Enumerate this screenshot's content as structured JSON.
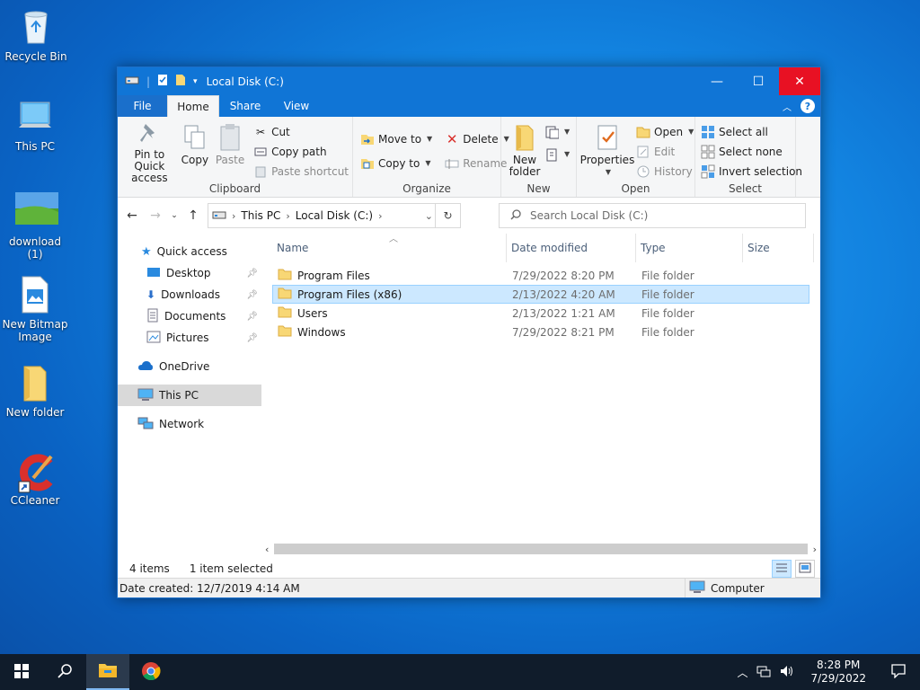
{
  "desktop": {
    "icons": [
      {
        "label": "Recycle Bin"
      },
      {
        "label": "This PC"
      },
      {
        "label": "download (1)"
      },
      {
        "label": "New Bitmap Image"
      },
      {
        "label": "New folder"
      },
      {
        "label": "CCleaner"
      }
    ]
  },
  "window": {
    "title": "Local Disk (C:)",
    "tabs": {
      "file": "File",
      "home": "Home",
      "share": "Share",
      "view": "View"
    },
    "ribbon": {
      "clipboard": {
        "label": "Clipboard",
        "pin": "Pin to Quick access",
        "copy": "Copy",
        "paste": "Paste",
        "cut": "Cut",
        "copy_path": "Copy path",
        "paste_shortcut": "Paste shortcut"
      },
      "organize": {
        "label": "Organize",
        "move_to": "Move to",
        "copy_to": "Copy to",
        "delete": "Delete",
        "rename": "Rename"
      },
      "new": {
        "label": "New",
        "new_folder": "New folder"
      },
      "open": {
        "label": "Open",
        "properties": "Properties",
        "open": "Open",
        "edit": "Edit",
        "history": "History"
      },
      "select": {
        "label": "Select",
        "select_all": "Select all",
        "select_none": "Select none",
        "invert": "Invert selection"
      }
    },
    "address": {
      "crumb1": "This PC",
      "crumb2": "Local Disk (C:)"
    },
    "search": {
      "placeholder": "Search Local Disk (C:)"
    },
    "nav": {
      "quick_access": "Quick access",
      "desktop": "Desktop",
      "downloads": "Downloads",
      "documents": "Documents",
      "pictures": "Pictures",
      "onedrive": "OneDrive",
      "this_pc": "This PC",
      "network": "Network"
    },
    "columns": {
      "name": "Name",
      "date": "Date modified",
      "type": "Type",
      "size": "Size"
    },
    "files": [
      {
        "name": "Program Files",
        "date": "7/29/2022 8:20 PM",
        "type": "File folder"
      },
      {
        "name": "Program Files (x86)",
        "date": "2/13/2022 4:20 AM",
        "type": "File folder"
      },
      {
        "name": "Users",
        "date": "2/13/2022 1:21 AM",
        "type": "File folder"
      },
      {
        "name": "Windows",
        "date": "7/29/2022 8:21 PM",
        "type": "File folder"
      }
    ],
    "status": {
      "items": "4 items",
      "selected": "1 item selected",
      "details": "Date created: 12/7/2019 4:14 AM",
      "location": "Computer"
    }
  },
  "taskbar": {
    "time": "8:28 PM",
    "date": "7/29/2022"
  },
  "colors": {
    "titlebar": "#1075d6",
    "close": "#e81123",
    "selection": "#cce8ff",
    "taskbar": "#101c2b"
  }
}
